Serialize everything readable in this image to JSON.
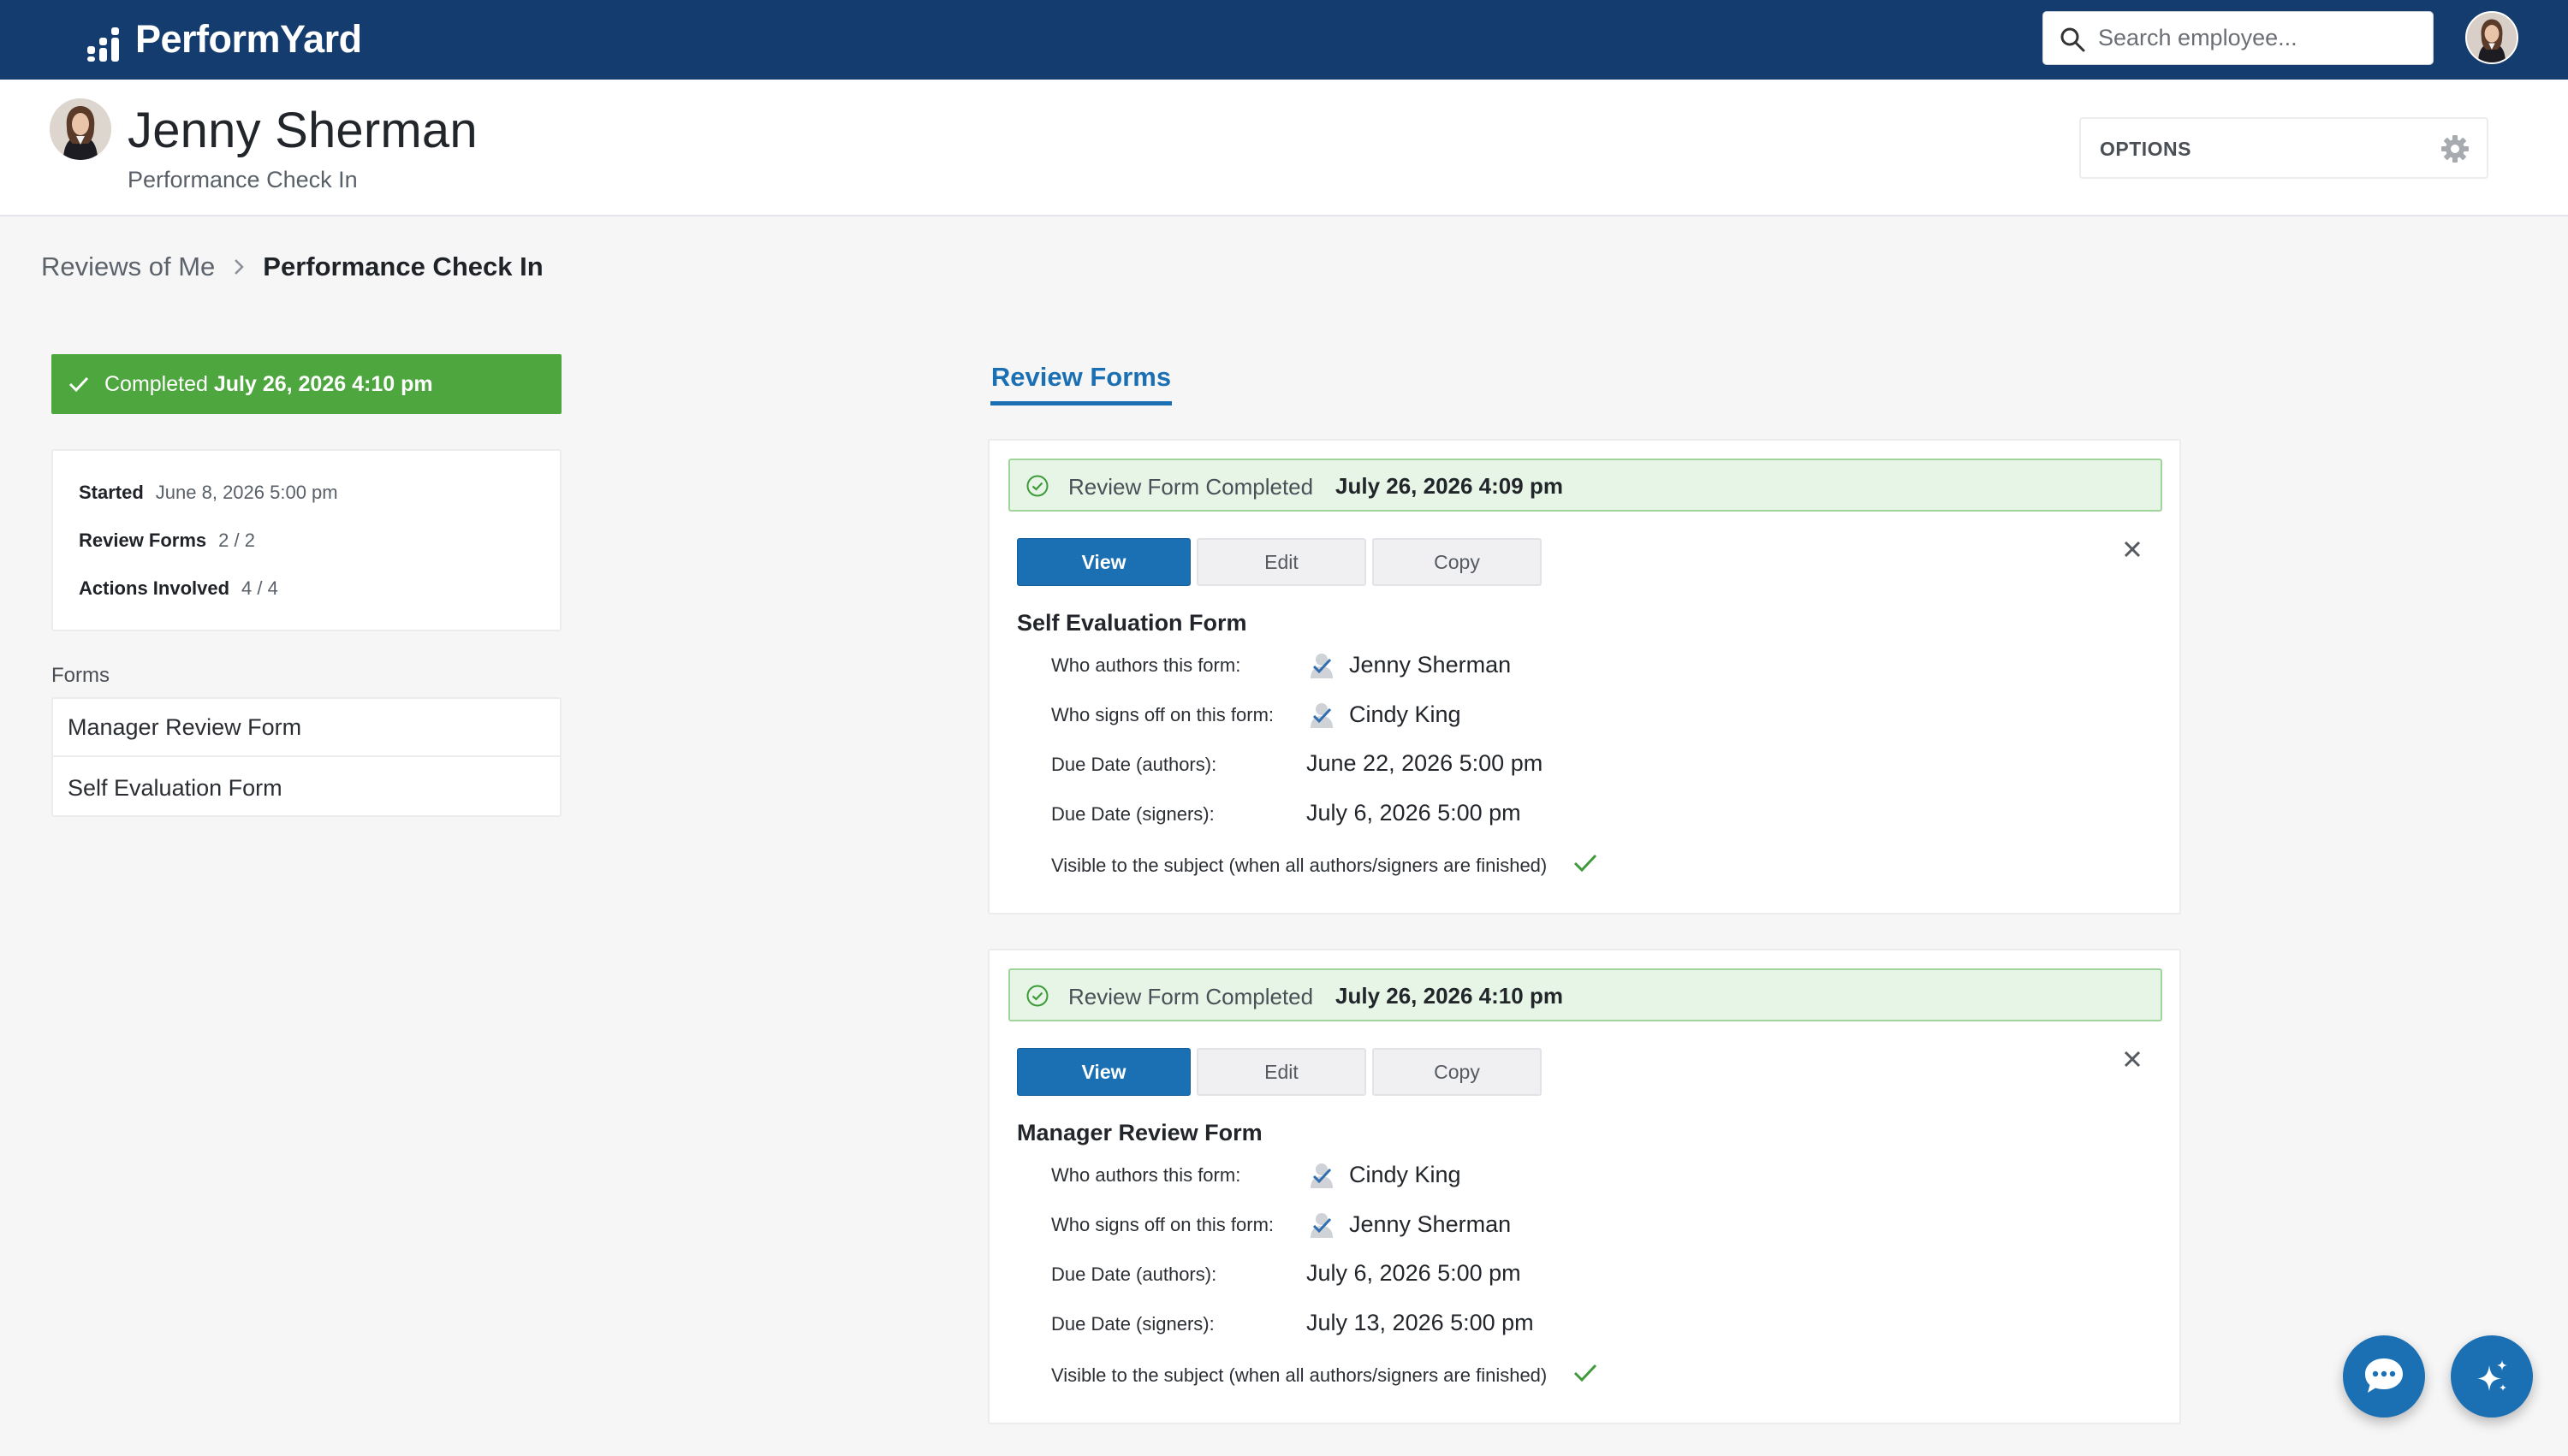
{
  "app": {
    "logo_text": "PerformYard"
  },
  "search": {
    "placeholder": "Search employee..."
  },
  "profile": {
    "name": "Jenny Sherman",
    "subtitle": "Performance Check In",
    "options_label": "OPTIONS"
  },
  "breadcrumb": {
    "parent": "Reviews of Me",
    "current": "Performance Check In"
  },
  "summary": {
    "completed_label": "Completed",
    "completed_date": "July 26, 2026 4:10 pm",
    "started_label": "Started",
    "started_value": "June 8, 2026 5:00 pm",
    "review_forms_label": "Review Forms",
    "review_forms_value": "2 / 2",
    "actions_label": "Actions Involved",
    "actions_value": "4 / 4"
  },
  "forms_sidebar": {
    "heading": "Forms",
    "items": [
      "Manager Review Form",
      "Self Evaluation Form"
    ]
  },
  "tab": {
    "label": "Review Forms"
  },
  "cards": [
    {
      "status_text": "Review Form Completed",
      "status_date": "July 26, 2026 4:09 pm",
      "buttons": {
        "view": "View",
        "edit": "Edit",
        "copy": "Copy"
      },
      "title": "Self Evaluation Form",
      "authors_label": "Who authors this form:",
      "authors_value": "Jenny Sherman",
      "signers_label": "Who signs off on this form:",
      "signers_value": "Cindy King",
      "due_authors_label": "Due Date (authors):",
      "due_authors_value": "June 22, 2026 5:00 pm",
      "due_signers_label": "Due Date (signers):",
      "due_signers_value": "July 6, 2026 5:00 pm",
      "visible_label": "Visible to the subject (when all authors/signers are finished)"
    },
    {
      "status_text": "Review Form Completed",
      "status_date": "July 26, 2026 4:10 pm",
      "buttons": {
        "view": "View",
        "edit": "Edit",
        "copy": "Copy"
      },
      "title": "Manager Review Form",
      "authors_label": "Who authors this form:",
      "authors_value": "Cindy King",
      "signers_label": "Who signs off on this form:",
      "signers_value": "Jenny Sherman",
      "due_authors_label": "Due Date (authors):",
      "due_authors_value": "July 6, 2026 5:00 pm",
      "due_signers_label": "Due Date (signers):",
      "due_signers_value": "July 13, 2026 5:00 pm",
      "visible_label": "Visible to the subject (when all authors/signers are finished)"
    }
  ],
  "colors": {
    "header": "#153c6e",
    "primary": "#1b6fb3",
    "success": "#4ea63e",
    "success_bg": "#e6f5e5"
  },
  "icons": [
    "search-icon",
    "gear-icon",
    "chevron-right-icon",
    "check-icon",
    "check-circle-icon",
    "close-icon",
    "person-check-icon",
    "chat-icon",
    "sparkle-icon"
  ]
}
